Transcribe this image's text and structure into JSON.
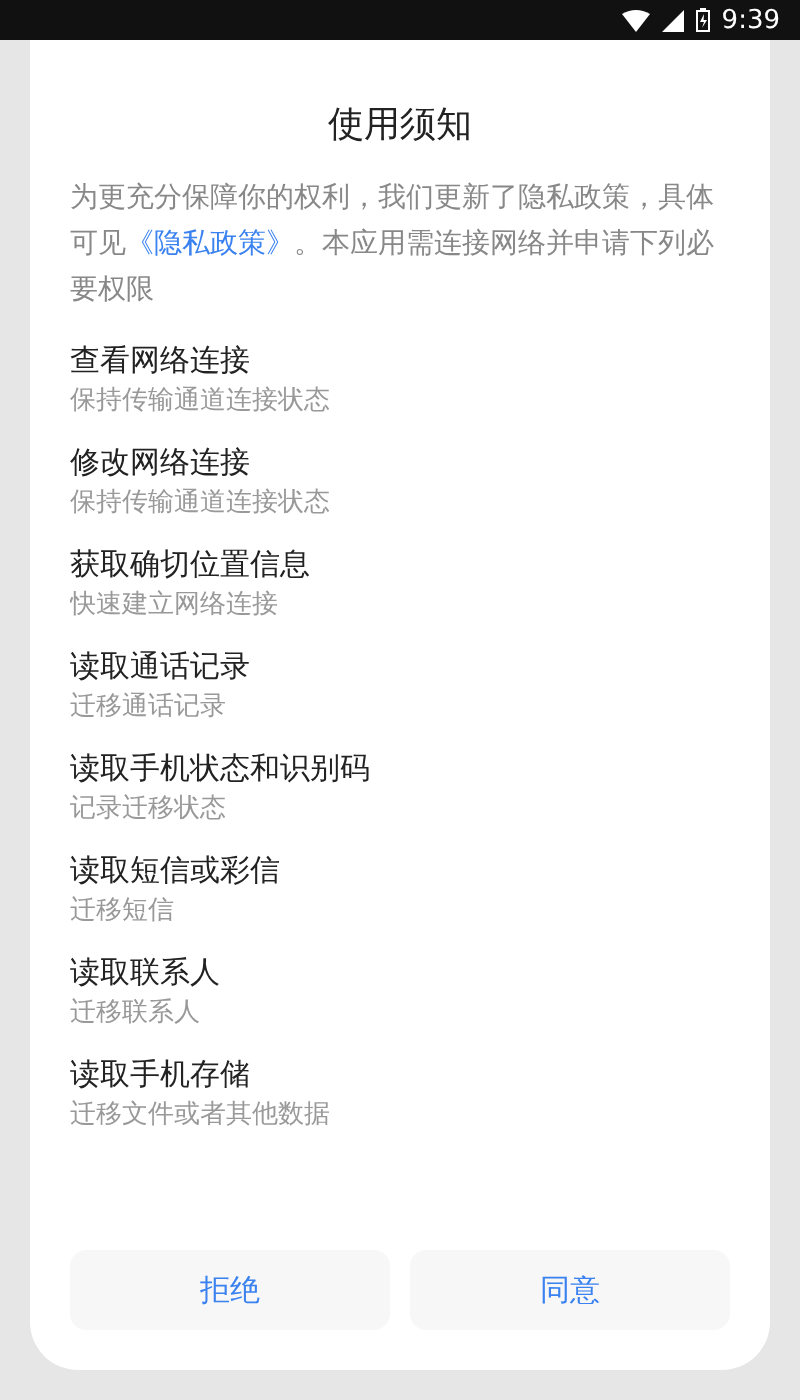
{
  "status_bar": {
    "time": "9:39"
  },
  "dialog": {
    "title": "使用须知",
    "intro_before": "为更充分保障你的权利，我们更新了隐私政策，具体可见",
    "intro_link": "《隐私政策》",
    "intro_after": "。本应用需连接网络并申请下列必要权限",
    "permissions": [
      {
        "title": "查看网络连接",
        "description": "保持传输通道连接状态"
      },
      {
        "title": "修改网络连接",
        "description": "保持传输通道连接状态"
      },
      {
        "title": "获取确切位置信息",
        "description": "快速建立网络连接"
      },
      {
        "title": "读取通话记录",
        "description": "迁移通话记录"
      },
      {
        "title": "读取手机状态和识别码",
        "description": "记录迁移状态"
      },
      {
        "title": "读取短信或彩信",
        "description": "迁移短信"
      },
      {
        "title": "读取联系人",
        "description": "迁移联系人"
      },
      {
        "title": "读取手机存储",
        "description": "迁移文件或者其他数据"
      }
    ],
    "buttons": [
      {
        "label": "拒绝"
      },
      {
        "label": "同意"
      }
    ]
  }
}
